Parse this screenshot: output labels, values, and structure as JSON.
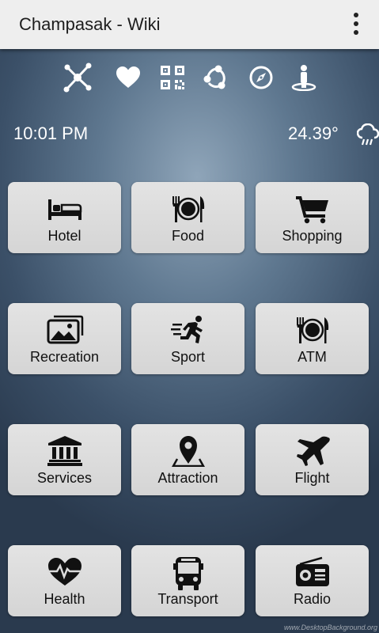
{
  "app": {
    "title": "Champasak - Wiki"
  },
  "toolbar_icons": [
    "network-icon",
    "heart-icon",
    "qr-code-icon",
    "share-icon",
    "compass-icon",
    "person-location-icon"
  ],
  "status": {
    "time": "10:01 PM",
    "temperature": "24.39°",
    "weather_icon": "rain-cloud-icon"
  },
  "tiles": [
    {
      "label": "Hotel",
      "icon": "bed-icon"
    },
    {
      "label": "Food",
      "icon": "plate-cutlery-icon"
    },
    {
      "label": "Shopping",
      "icon": "shopping-cart-icon"
    },
    {
      "label": "Recreation",
      "icon": "photos-icon"
    },
    {
      "label": "Sport",
      "icon": "running-icon"
    },
    {
      "label": "ATM",
      "icon": "plate-cutlery-icon"
    },
    {
      "label": "Services",
      "icon": "bank-building-icon"
    },
    {
      "label": "Attraction",
      "icon": "map-pin-icon"
    },
    {
      "label": "Flight",
      "icon": "airplane-icon"
    },
    {
      "label": "Health",
      "icon": "heart-pulse-icon"
    },
    {
      "label": "Transport",
      "icon": "bus-icon"
    },
    {
      "label": "Radio",
      "icon": "radio-icon"
    }
  ],
  "watermark": "www.DesktopBackground.org"
}
